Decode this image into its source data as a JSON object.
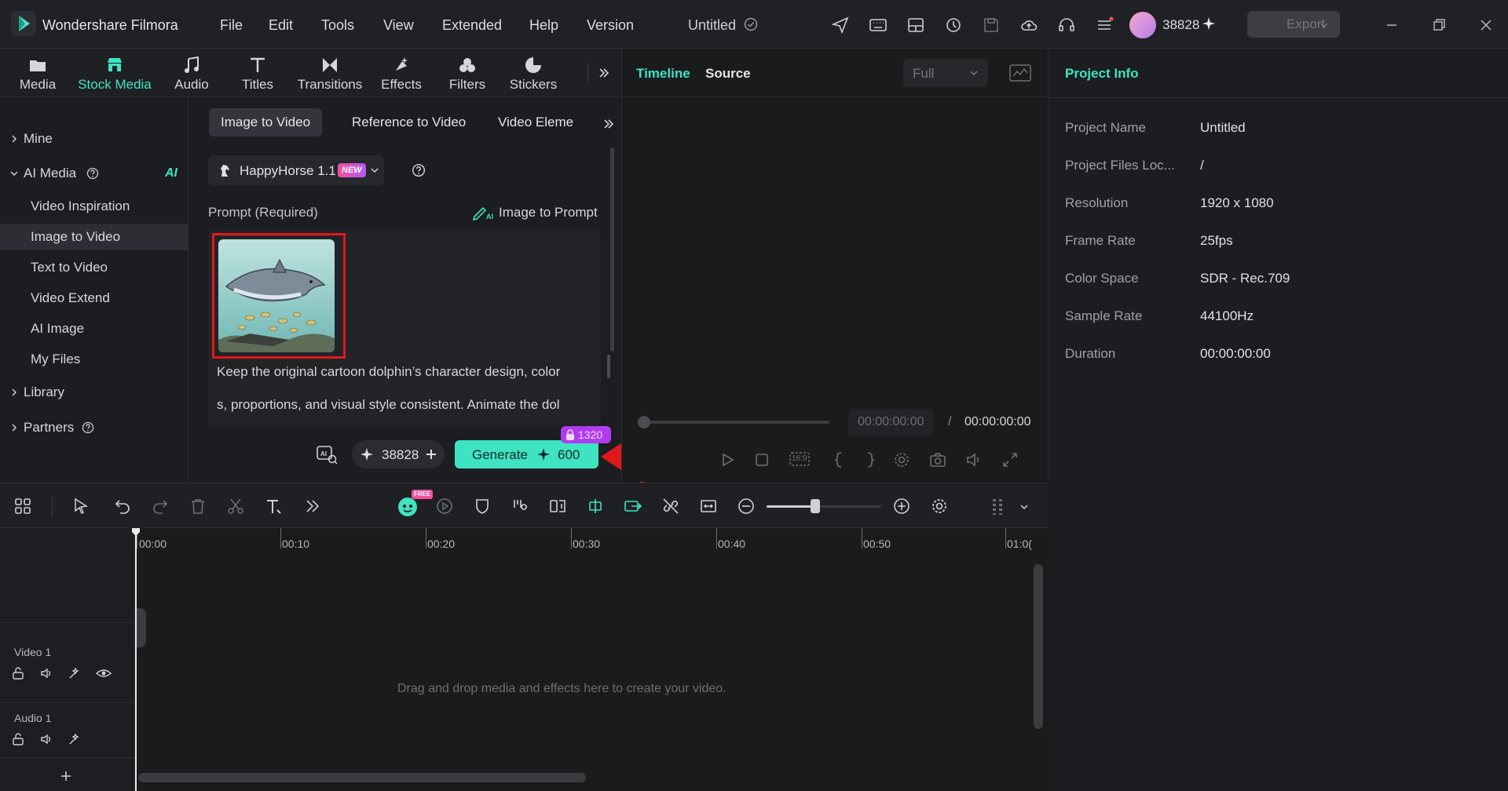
{
  "app": {
    "name": "Wondershare Filmora",
    "project_title": "Untitled",
    "credits": "38828",
    "export_label": "Export"
  },
  "menu": [
    "File",
    "Edit",
    "Tools",
    "View",
    "Extended",
    "Help",
    "Version"
  ],
  "media_tabs": [
    {
      "label": "Media",
      "icon": "folder-icon"
    },
    {
      "label": "Stock Media",
      "icon": "store-icon",
      "active": true
    },
    {
      "label": "Audio",
      "icon": "music-note-icon"
    },
    {
      "label": "Titles",
      "icon": "text-t-icon"
    },
    {
      "label": "Transitions",
      "icon": "transition-icon"
    },
    {
      "label": "Effects",
      "icon": "effects-icon"
    },
    {
      "label": "Filters",
      "icon": "filters-icon"
    },
    {
      "label": "Stickers",
      "icon": "sticker-icon"
    }
  ],
  "left_nav": {
    "mine": "Mine",
    "ai_media": "AI Media",
    "ai_badge": "AI",
    "items": [
      "Video Inspiration",
      "Image to Video",
      "Text to Video",
      "Video Extend",
      "AI Image",
      "My Files"
    ],
    "selected": "Image to Video",
    "library": "Library",
    "partners": "Partners"
  },
  "subtabs": [
    "Image to Video",
    "Reference to Video",
    "Video Eleme"
  ],
  "model": {
    "name": "HappyHorse 1.1",
    "badge": "NEW"
  },
  "prompt": {
    "label": "Prompt (Required)",
    "image_to_prompt": "Image to Prompt",
    "line1": "Keep the original cartoon dolphin’s character design, color",
    "line2": "s, proportions, and visual style consistent. Animate the dol"
  },
  "generate": {
    "credits_pill": "38828",
    "label": "Generate",
    "cost": "600",
    "old_cost": "1320"
  },
  "preview": {
    "tab_timeline": "Timeline",
    "tab_source": "Source",
    "quality": "Full",
    "time_current": "00:00:00:00",
    "separator": "/",
    "time_total": "00:00:00:00",
    "ratio": "16:9"
  },
  "project_info": {
    "title": "Project Info",
    "rows": [
      {
        "label": "Project Name",
        "value": "Untitled"
      },
      {
        "label": "Project Files Loc...",
        "value": "/"
      },
      {
        "label": "Resolution",
        "value": "1920 x 1080"
      },
      {
        "label": "Frame Rate",
        "value": "25fps"
      },
      {
        "label": "Color Space",
        "value": "SDR - Rec.709"
      },
      {
        "label": "Sample Rate",
        "value": "44100Hz"
      },
      {
        "label": "Duration",
        "value": "00:00:00:00"
      }
    ]
  },
  "timeline": {
    "ruler": [
      "00:00",
      "00:10",
      "00:20",
      "00:30",
      "00:40",
      "00:50",
      "01:0("
    ],
    "tracks": [
      "Video 1",
      "Audio 1"
    ],
    "empty_hint": "Drag and drop media and effects here to create your video.",
    "free_badge": "FREE"
  },
  "colors": {
    "accent": "#3ee3c2",
    "highlight_box": "#e0191d",
    "arrow": "#e0191d",
    "badge_purple": "#b03cf0"
  }
}
